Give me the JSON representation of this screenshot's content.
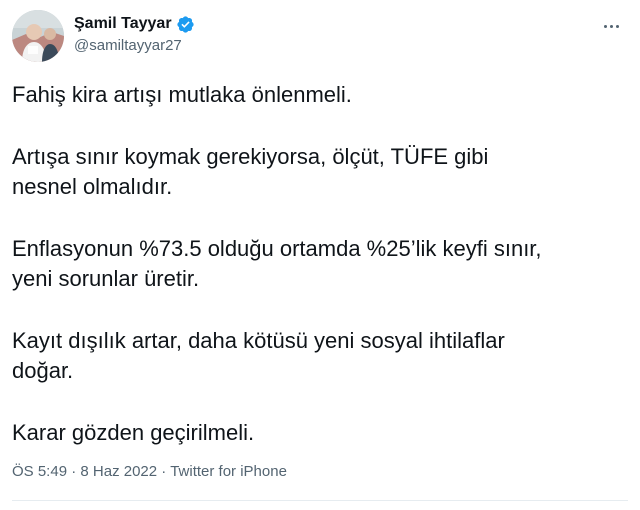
{
  "author": {
    "display_name": "Şamil Tayyar",
    "handle": "@samiltayyar27",
    "verified_icon": "verified-badge-icon",
    "verified_color": "#1d9bf0"
  },
  "tweet": {
    "paragraphs": [
      "Fahiş kira artışı mutlaka önlenmeli.",
      "Artışa sınır koymak gerekiyorsa, ölçüt, TÜFE gibi\nnesnel olmalıdır.",
      "Enflasyonun %73.5 olduğu ortamda %25’lik keyfi sınır,\nyeni sorunlar üretir.",
      "Kayıt dışılık artar, daha kötüsü yeni sosyal ihtilaflar\ndoğar.",
      "Karar gözden geçirilmeli."
    ],
    "time": "ÖS 5:49",
    "separator": " · ",
    "date": "8 Haz 2022",
    "source": "Twitter for iPhone"
  },
  "more_icon": "more-options-icon"
}
